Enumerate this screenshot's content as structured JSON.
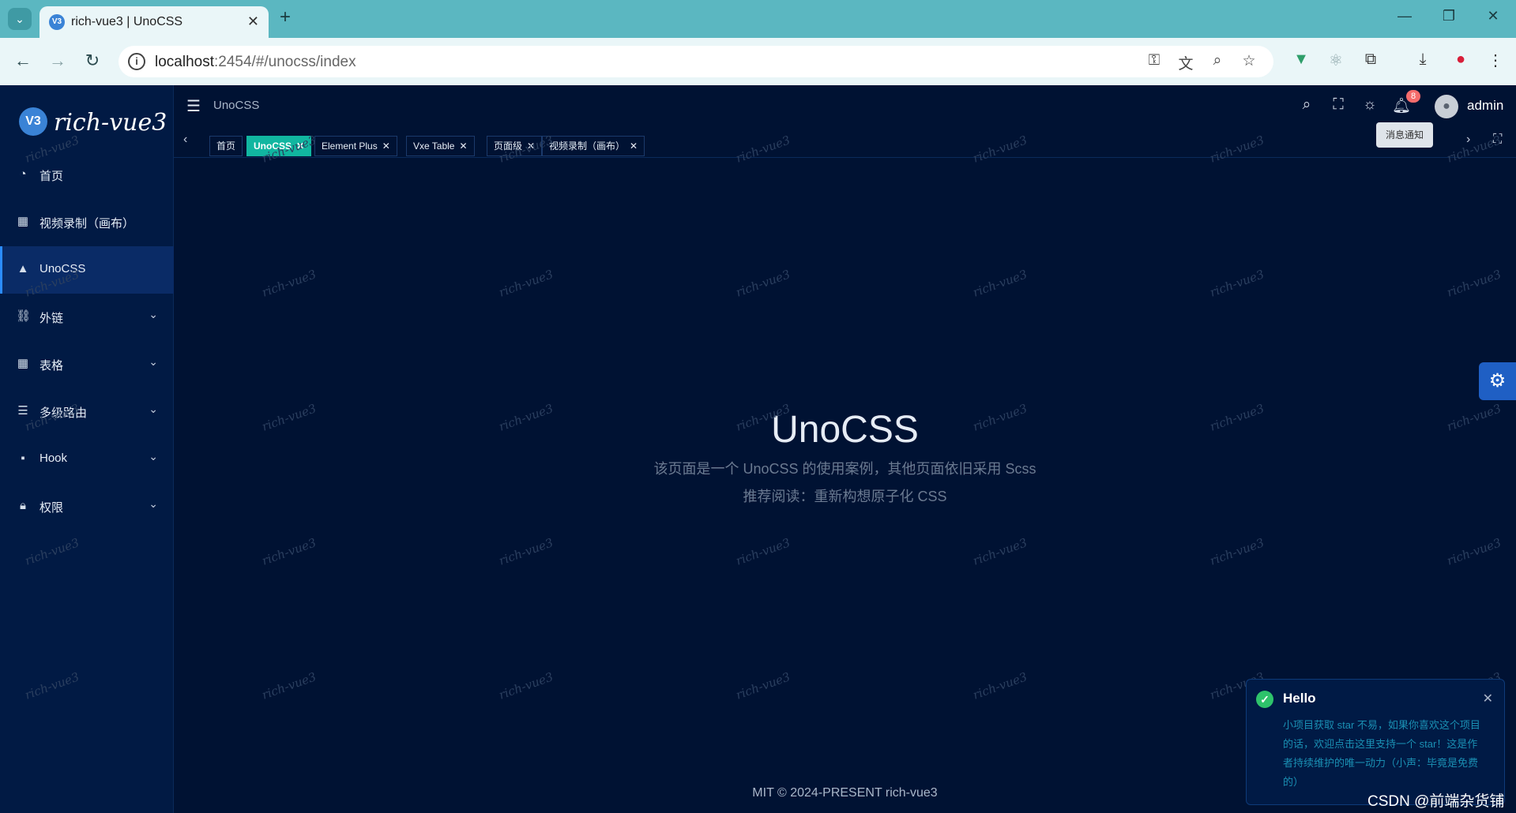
{
  "browser": {
    "tab_title": "rich-vue3 | UnoCSS",
    "favicon_label": "V3",
    "url_host": "localhost",
    "url_rest": ":2454/#/unocss/index",
    "icons": [
      "chevron-down-icon",
      "close-icon",
      "plus-icon",
      "minimize-icon",
      "restore-icon",
      "close-window-icon",
      "back-icon",
      "forward-icon",
      "reload-icon",
      "site-info-icon",
      "key-icon",
      "translate-icon",
      "zoom-icon",
      "star-icon",
      "vue-devtools-icon",
      "react-icon",
      "extensions-icon",
      "download-icon",
      "profile-icon",
      "menu-dots-icon"
    ]
  },
  "app": {
    "logo_text": "rich-vue3",
    "logo_mark": "V3",
    "menu": [
      {
        "label": "首页",
        "icon": "dashboard-icon",
        "has_children": false,
        "active": false
      },
      {
        "label": "视频录制（画布）",
        "icon": "table-icon",
        "has_children": false,
        "active": false
      },
      {
        "label": "UnoCSS",
        "icon": "shapes-icon",
        "has_children": false,
        "active": true
      },
      {
        "label": "外链",
        "icon": "link-icon",
        "has_children": true,
        "active": false
      },
      {
        "label": "表格",
        "icon": "grid-icon",
        "has_children": true,
        "active": false
      },
      {
        "label": "多级路由",
        "icon": "list-icon",
        "has_children": true,
        "active": false
      },
      {
        "label": "Hook",
        "icon": "apps-icon",
        "has_children": true,
        "active": false
      },
      {
        "label": "权限",
        "icon": "lock-icon",
        "has_children": true,
        "active": false
      }
    ],
    "breadcrumb": "UnoCSS",
    "notification_count": "8",
    "tooltip": "消息通知",
    "username": "admin",
    "tags": [
      {
        "label": "首页",
        "closable": false,
        "active": false
      },
      {
        "label": "UnoCSS",
        "closable": true,
        "active": true
      },
      {
        "label": "Element Plus",
        "closable": true,
        "active": false
      },
      {
        "label": "Vxe Table",
        "closable": true,
        "active": false
      },
      {
        "label": "页面级",
        "closable": true,
        "active": false
      },
      {
        "label": "视频录制（画布）",
        "closable": true,
        "active": false
      }
    ],
    "content": {
      "title": "UnoCSS",
      "description": "该页面是一个 UnoCSS 的使用案例，其他页面依旧采用 Scss",
      "link": "推荐阅读：重新构想原子化 CSS"
    },
    "footer": "MIT © 2024-PRESENT rich-vue3",
    "watermark": "rich-vue3",
    "notification": {
      "title": "Hello",
      "body": "小项目获取 star 不易，如果你喜欢这个项目的话，欢迎点击这里支持一个 star！这是作者持续维护的唯一动力（小声：毕竟是免费的）"
    },
    "csdn_watermark": "CSDN @前端杂货铺"
  },
  "colors": {
    "accent": "#11b6a0",
    "sidebar_bg": "#011a44",
    "page_bg": "#001233",
    "badge": "#f56c6c"
  }
}
